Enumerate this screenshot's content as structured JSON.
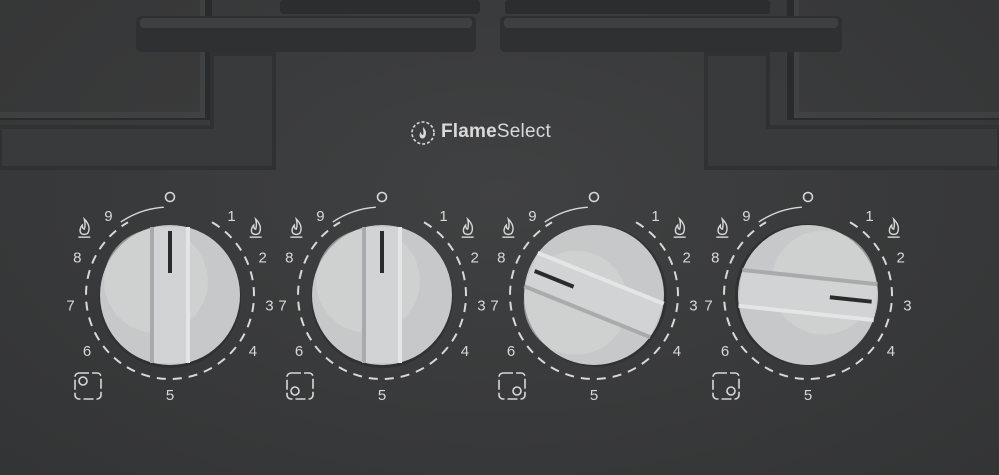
{
  "brand": {
    "name_bold": "Flame",
    "name_light": "Select",
    "icon": "flame-dial-icon"
  },
  "dial_scale": [
    "9",
    "1",
    "2",
    "3",
    "4",
    "5",
    "6",
    "7",
    "8"
  ],
  "knobs": [
    {
      "id": "rear-left",
      "setting": "off",
      "zone_icon": "burner-position-rear-left-icon"
    },
    {
      "id": "front-left",
      "setting": "off",
      "zone_icon": "burner-position-front-left-icon"
    },
    {
      "id": "front-right",
      "setting": "8",
      "zone_icon": "burner-position-front-right-icon"
    },
    {
      "id": "rear-right",
      "setting": "3",
      "zone_icon": "burner-position-rear-right-icon"
    }
  ],
  "colors": {
    "panel": "#3a3b3c",
    "grate": "#2e2f30",
    "knob": "#c9cacb",
    "print": "#d8d8d8"
  }
}
